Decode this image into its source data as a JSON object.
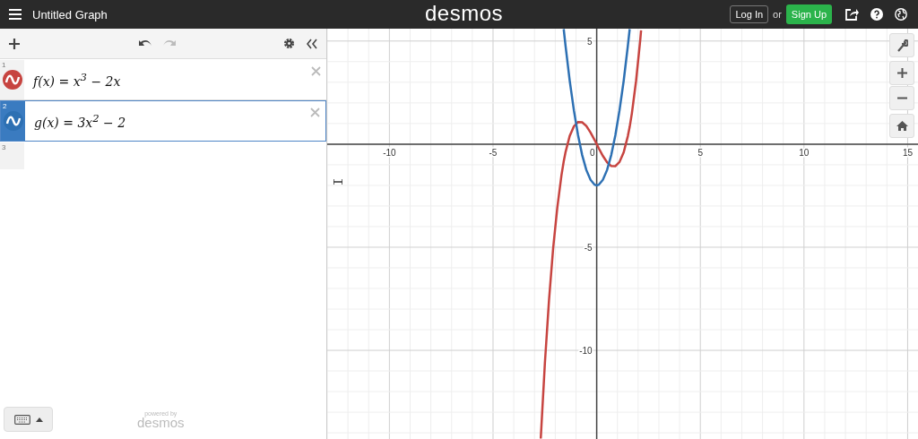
{
  "topbar": {
    "title": "Untitled Graph",
    "logo": "desmos",
    "login": "Log In",
    "or": "or",
    "signup": "Sign Up"
  },
  "expressions": [
    {
      "index": "1",
      "latex": "f(x) = x$^{3}$ − 2x",
      "color": "#c74440",
      "selected": false
    },
    {
      "index": "2",
      "latex": "g(x) = 3x$^{2}$ − 2",
      "color": "#2d70b3",
      "selected": true
    }
  ],
  "next_index": "3",
  "footer": {
    "powered_by": "powered by",
    "logo": "desmos"
  },
  "graph": {
    "chart_data": {
      "type": "line",
      "x": [
        -2.7,
        -2.5,
        -2.3,
        -2.1,
        -1.9,
        -1.7,
        -1.59,
        -1.5,
        -1.3,
        -1.1,
        -0.9,
        -0.7,
        -0.5,
        -0.3,
        -0.1,
        0,
        0.1,
        0.3,
        0.5,
        0.7,
        0.9,
        1.1,
        1.3,
        1.5,
        1.59,
        1.7,
        1.9,
        2.1,
        2.14
      ],
      "series": [
        {
          "color": "#c74440",
          "values": [
            -14.28,
            -10.63,
            -7.57,
            -5.06,
            -3.06,
            -1.51,
            -0.84,
            -0.38,
            0.4,
            0.87,
            1.07,
            1.06,
            0.88,
            0.57,
            0.2,
            0,
            -0.2,
            -0.57,
            -0.88,
            -1.06,
            -1.07,
            -0.87,
            -0.4,
            0.38,
            0.84,
            1.51,
            3.06,
            5.06,
            5.52
          ]
        },
        {
          "color": "#2d70b3",
          "values": [
            null,
            null,
            null,
            null,
            null,
            null,
            5.58,
            4.75,
            3.07,
            1.63,
            0.43,
            -0.53,
            -1.25,
            -1.73,
            -1.97,
            -2,
            -1.97,
            -1.73,
            -1.25,
            -0.53,
            0.43,
            1.63,
            3.07,
            4.75,
            5.58,
            null,
            null,
            null,
            null
          ]
        }
      ],
      "xlim": [
        -13,
        15.5
      ],
      "ylim": [
        -14.3,
        5.6
      ],
      "xticks": [
        -10,
        -5,
        {
          "value": 0,
          "label": "0"
        },
        5,
        10,
        15
      ],
      "yticks": [
        5,
        -5,
        -10
      ],
      "grid": true
    }
  }
}
